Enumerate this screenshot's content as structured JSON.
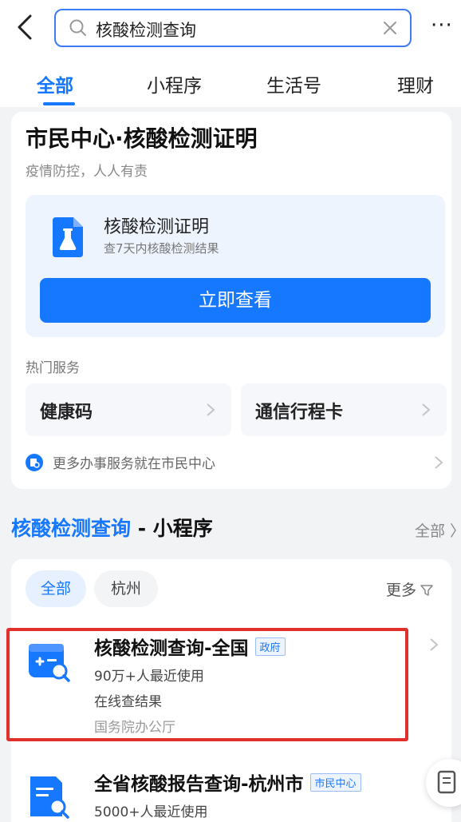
{
  "search": {
    "query": "核酸检测查询"
  },
  "tabs": [
    {
      "label": "全部",
      "active": true
    },
    {
      "label": "小程序"
    },
    {
      "label": "生活号"
    },
    {
      "label": "理财"
    }
  ],
  "citizen_card": {
    "title": "市民中心·核酸检测证明",
    "subtitle": "疫情防控，人人有责",
    "feature": {
      "name": "核酸检测证明",
      "desc": "查7天内核酸检测结果",
      "button": "立即查看"
    },
    "hot_label": "热门服务",
    "services": [
      "健康码",
      "通信行程卡"
    ],
    "more_text": "更多办事服务就在市民中心"
  },
  "section": {
    "title_highlight": "核酸检测查询",
    "title_rest": " - 小程序",
    "all": "全部 〉"
  },
  "filters": {
    "chips": [
      "全部",
      "杭州"
    ],
    "more": "更多"
  },
  "results": [
    {
      "name": "核酸检测查询-全国",
      "tag": "政府",
      "usage": "90万+人最近使用",
      "desc": "在线查结果",
      "provider": "国务院办公厅"
    },
    {
      "name": "全省核酸报告查询-杭州市",
      "tag": "市民中心",
      "usage": "5000+人最近使用"
    }
  ],
  "colors": {
    "accent": "#1677ff",
    "highlight_box": "#e0302b"
  }
}
